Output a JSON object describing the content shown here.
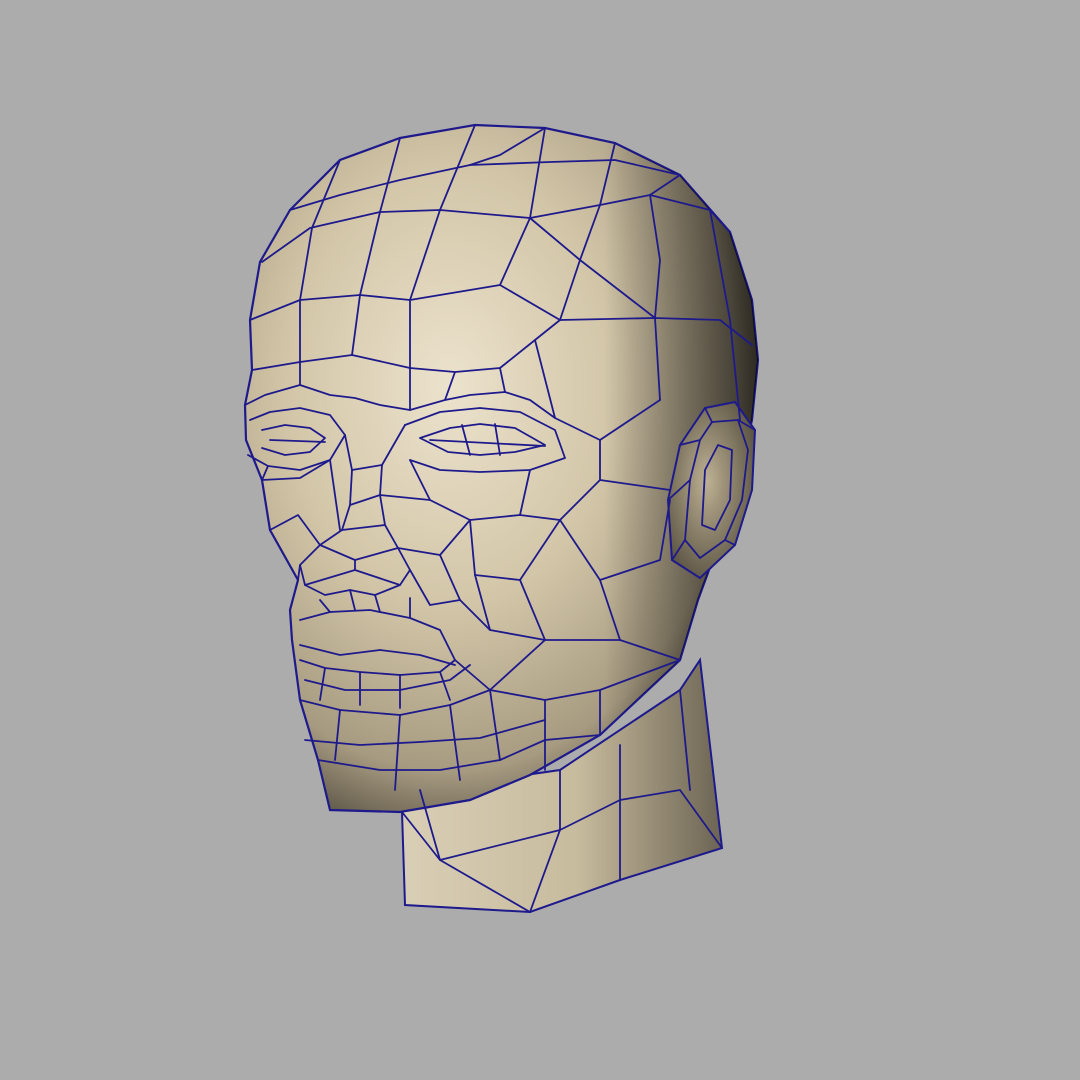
{
  "viewport": {
    "background_color": "#acacac",
    "subject": "head-mesh-icon"
  },
  "mesh": {
    "shading": "smooth-shaded-with-wireframe",
    "surface_color": "#cdbf9f",
    "highlight_color": "#e6dcc5",
    "shadow_color": "#2a2620",
    "wire_color": "#1e1a8c"
  }
}
